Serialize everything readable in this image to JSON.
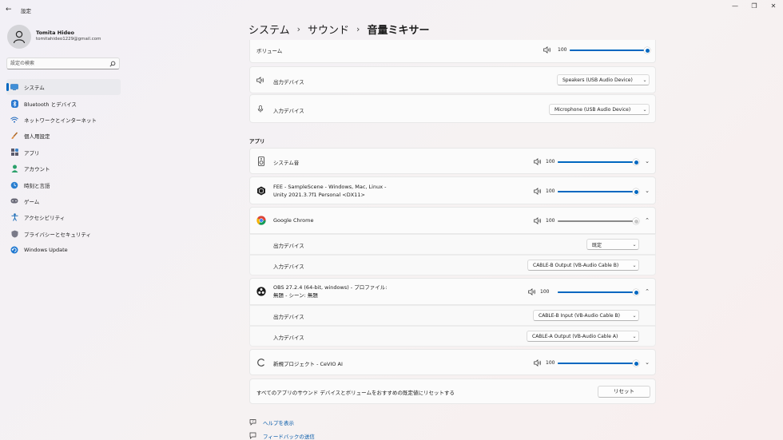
{
  "window": {
    "title": "設定",
    "back_icon": "back-arrow-icon",
    "controls": [
      "minimize-icon",
      "restore-icon",
      "close-icon"
    ]
  },
  "profile": {
    "name": "Tomita Hideo",
    "email": "tomitahideo1229@gmail.com"
  },
  "search": {
    "placeholder": "設定の検索"
  },
  "sidebar": {
    "items": [
      {
        "label": "システム",
        "icon": "system-icon",
        "active": true
      },
      {
        "label": "Bluetooth とデバイス",
        "icon": "bluetooth-icon"
      },
      {
        "label": "ネットワークとインターネット",
        "icon": "wifi-icon"
      },
      {
        "label": "個人用設定",
        "icon": "brush-icon"
      },
      {
        "label": "アプリ",
        "icon": "apps-icon"
      },
      {
        "label": "アカウント",
        "icon": "account-icon"
      },
      {
        "label": "時刻と言語",
        "icon": "time-language-icon"
      },
      {
        "label": "ゲーム",
        "icon": "gamepad-icon"
      },
      {
        "label": "アクセシビリティ",
        "icon": "accessibility-icon"
      },
      {
        "label": "プライバシーとセキュリティ",
        "icon": "shield-icon"
      },
      {
        "label": "Windows Update",
        "icon": "windows-update-icon"
      }
    ]
  },
  "breadcrumb": {
    "items": [
      "システム",
      "サウンド",
      "音量ミキサー"
    ],
    "separator": "›"
  },
  "system": {
    "volume_label": "ボリューム",
    "volume_value": "100",
    "volume_level": 1.0,
    "output_label": "出力デバイス",
    "output_value": "Speakers (USB Audio Device)",
    "input_label": "入力デバイス",
    "input_value": "Microphone (USB Audio Device)"
  },
  "apps_section_title": "アプリ",
  "apps": [
    {
      "name": "システム音",
      "icon": "system-sounds-icon",
      "volume": "100",
      "level": 1.0,
      "expanded": false
    },
    {
      "name": "FEE - SampleScene - Windows, Mac, Linux - Unity 2021.3.7f1 Personal <DX11>",
      "icon": "unity-icon",
      "volume": "100",
      "level": 1.0,
      "expanded": false
    },
    {
      "name": "Google Chrome",
      "icon": "chrome-icon",
      "volume": "100",
      "level": 1.0,
      "expanded": true,
      "muted_slider": true,
      "output_label": "出力デバイス",
      "output_value": "既定",
      "input_label": "入力デバイス",
      "input_value": "CABLE-B Output (VB-Audio Cable B)"
    },
    {
      "name": "OBS 27.2.4 (64-bit, windows) - プロファイル: 無題 - シーン: 無題",
      "icon": "obs-icon",
      "volume": "100",
      "level": 1.0,
      "expanded": true,
      "output_label": "出力デバイス",
      "output_value": "CABLE-B Input (VB-Audio Cable B)",
      "input_label": "入力デバイス",
      "input_value": "CABLE-A Output (VB-Audio Cable A)"
    },
    {
      "name": "新規プロジェクト - CeVIO AI",
      "icon": "cevio-icon",
      "volume": "100",
      "level": 1.0,
      "expanded": false
    }
  ],
  "reset": {
    "label": "すべてのアプリのサウンド デバイスとボリュームをおすすめの既定値にリセットする",
    "button": "リセット"
  },
  "links": {
    "help": "ヘルプを表示",
    "feedback": "フィードバックの送信"
  },
  "colors": {
    "accent": "#0067c0",
    "muted_thumb": "#c8c8c8"
  }
}
